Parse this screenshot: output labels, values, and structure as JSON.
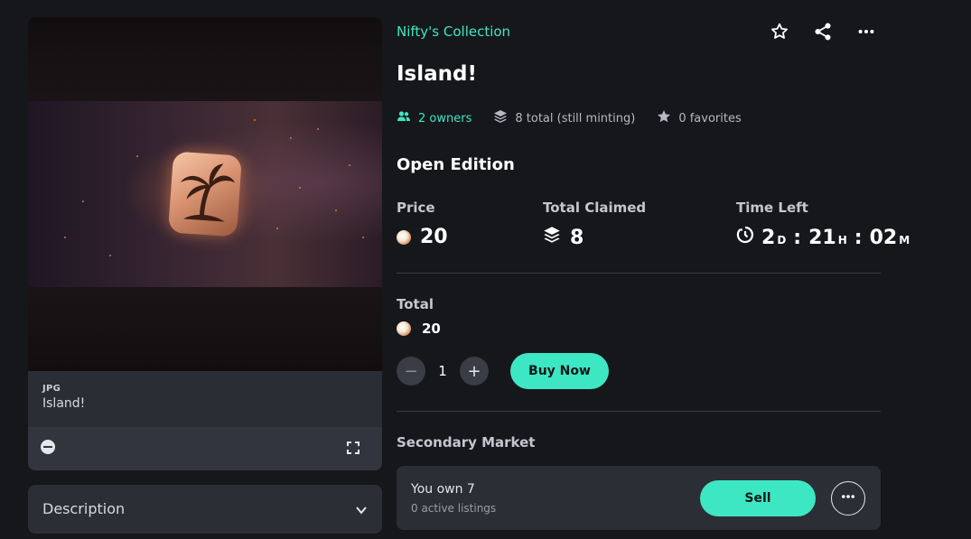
{
  "media": {
    "file_type": "JPG",
    "name": "Island!"
  },
  "description": {
    "label": "Description"
  },
  "header": {
    "collection": "Nifty's Collection",
    "title": "Island!",
    "icons": [
      "star-icon",
      "share-icon",
      "more-horizontal-icon"
    ]
  },
  "stats": {
    "owners": "2 owners",
    "total": "8 total (still minting)",
    "favorites": "0 favorites"
  },
  "edition": {
    "title": "Open Edition",
    "price_label": "Price",
    "price_value": "20",
    "claimed_label": "Total Claimed",
    "claimed_value": "8",
    "time_label": "Time Left",
    "time": {
      "days": "2",
      "days_unit": "D",
      "hours": "21",
      "hours_unit": "H",
      "minutes": "02",
      "minutes_unit": "M",
      "separator": ":"
    }
  },
  "purchase": {
    "total_label": "Total",
    "total_value": "20",
    "minus": "−",
    "quantity": "1",
    "plus": "+",
    "buy_label": "Buy Now"
  },
  "secondary": {
    "label": "Secondary Market",
    "own_text": "You own 7",
    "listings_text": "0 active listings",
    "sell_label": "Sell"
  },
  "colors": {
    "accent": "#3ee7c4",
    "background": "#16171b",
    "card": "#2c2e36"
  }
}
